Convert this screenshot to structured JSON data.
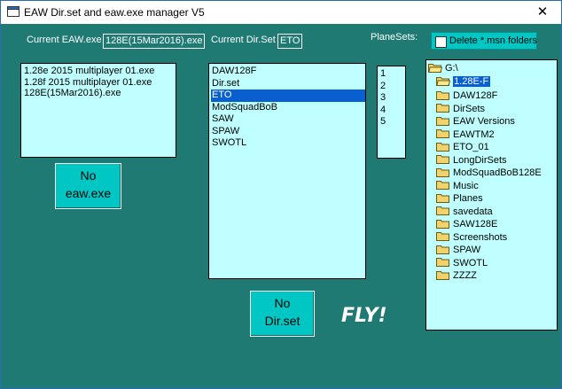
{
  "window": {
    "title": "EAW Dir.set and eaw.exe manager V5",
    "close_glyph": "✕"
  },
  "header": {
    "current_eaw_label": "Current EAW.exe",
    "current_eaw_value": "128E(15Mar2016).exe",
    "current_dirset_label": "Current Dir.Set",
    "current_dirset_value": "ETO",
    "planesets_label": "PlaneSets:",
    "delete_msn_label": "Delete *.msn folders",
    "delete_msn_checked": false
  },
  "exe_list": {
    "items": [
      "1.28e 2015 multiplayer 01.exe",
      "1.28f 2015 multiplayer 01.exe",
      "128E(15Mar2016).exe"
    ]
  },
  "dirset_list": {
    "items": [
      "DAW128F",
      "Dir.set",
      "ETO",
      "ModSquadBoB",
      "SAW",
      "SPAW",
      "SWOTL"
    ],
    "selected": "ETO"
  },
  "planesets_list": {
    "items": [
      "1",
      "2",
      "3",
      "4",
      "5"
    ]
  },
  "buttons": {
    "no_exe": {
      "line1": "No",
      "line2": "eaw.exe"
    },
    "no_dirset": {
      "line1": "No",
      "line2": "Dir.set"
    },
    "fly": "FLY!"
  },
  "folder_tree": {
    "drive": "G:\\",
    "current": "1.28E-F",
    "children": [
      "DAW128F",
      "DirSets",
      "EAW Versions",
      "EAWTM2",
      "ETO_01",
      "LongDirSets",
      "ModSquadBoB128E",
      "Music",
      "Planes",
      "savedata",
      "SAW128E",
      "Screenshots",
      "SPAW",
      "SWOTL",
      "ZZZZ"
    ]
  },
  "colors": {
    "background": "#1f7a73",
    "list_bg": "#bfffff",
    "button_bg": "#00c7c3",
    "selection": "#0a5fd0",
    "folder": "#f2d36b"
  }
}
